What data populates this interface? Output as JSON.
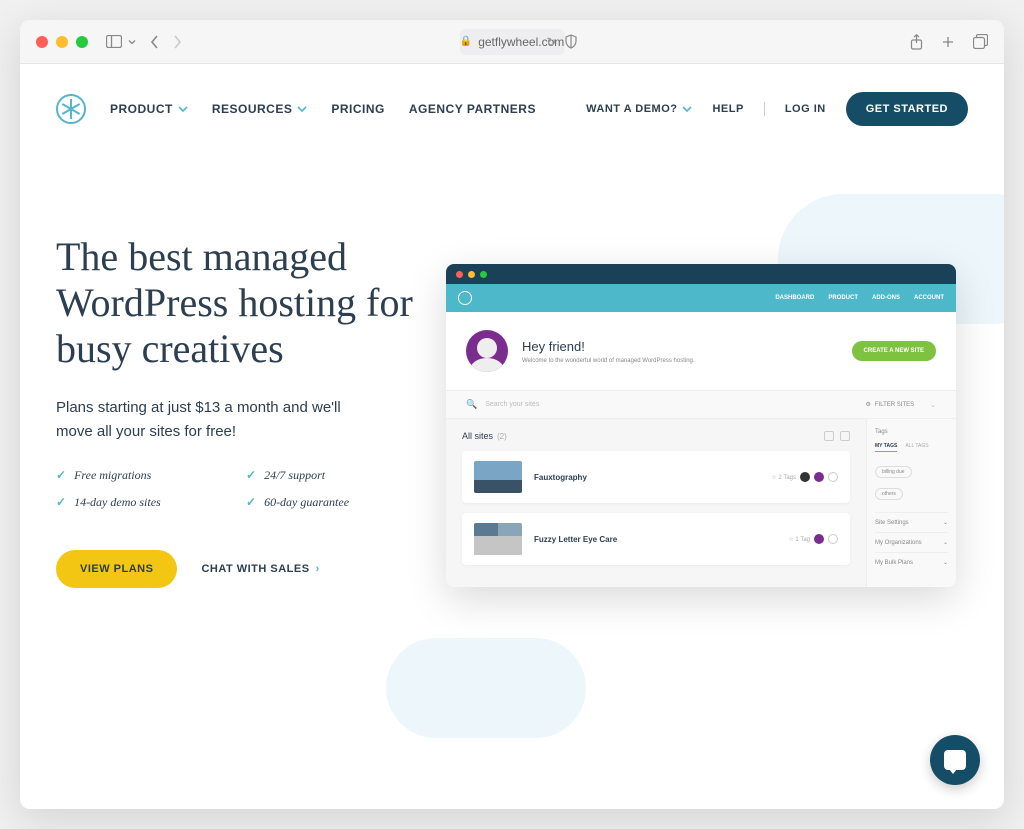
{
  "browser": {
    "url": "getflywheel.com"
  },
  "nav": {
    "items": [
      {
        "label": "PRODUCT",
        "dropdown": true
      },
      {
        "label": "RESOURCES",
        "dropdown": true
      },
      {
        "label": "PRICING",
        "dropdown": false
      },
      {
        "label": "AGENCY PARTNERS",
        "dropdown": false
      }
    ],
    "right": {
      "demo": "WANT A DEMO?",
      "help": "HELP",
      "login": "LOG IN",
      "cta": "GET STARTED"
    }
  },
  "hero": {
    "title": "The best managed WordPress hosting for busy creatives",
    "subtitle": "Plans starting at just $13 a month and we'll move all your sites for free!",
    "features": [
      "Free migrations",
      "24/7 support",
      "14-day demo sites",
      "60-day guarantee"
    ],
    "primary_cta": "VIEW PLANS",
    "secondary_cta": "CHAT WITH SALES"
  },
  "dashboard": {
    "header_links": [
      "DASHBOARD",
      "PRODUCT",
      "ADD-ONS",
      "ACCOUNT"
    ],
    "welcome_title": "Hey friend!",
    "welcome_sub": "Welcome to the wonderful world of managed WordPress hosting.",
    "create_btn": "CREATE A NEW SITE",
    "search_placeholder": "Search your sites",
    "filter_label": "FILTER SITES",
    "all_sites_label": "All sites",
    "all_sites_count": "(2)",
    "sites": [
      {
        "name": "Fauxtography",
        "meta": "2 Tags"
      },
      {
        "name": "Fuzzy Letter Eye Care",
        "meta": "1 Tag"
      }
    ],
    "sidebar": {
      "tags_label": "Tags",
      "tabs": [
        "MY TAGS",
        "ALL TAGS"
      ],
      "pills": [
        "billing due",
        "others"
      ],
      "items": [
        "Site Settings",
        "My Organizations",
        "My Bulk Plans"
      ]
    }
  }
}
